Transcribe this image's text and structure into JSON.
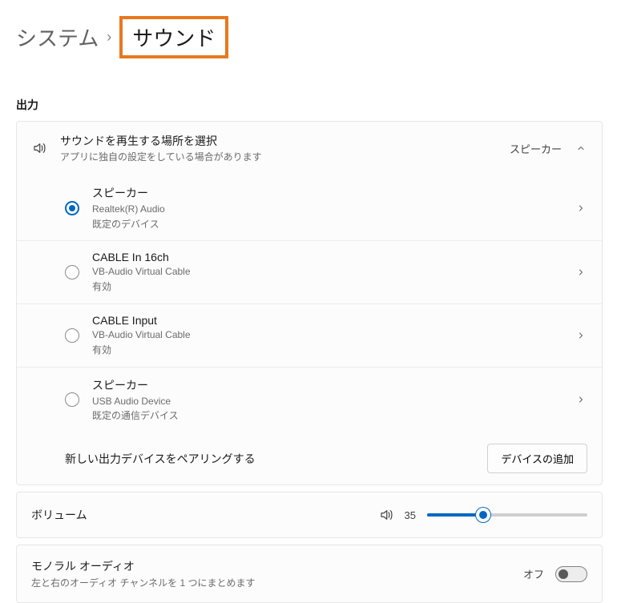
{
  "breadcrumb": {
    "parent": "システム",
    "separator": "›",
    "current": "サウンド"
  },
  "section_output": "出力",
  "output_header": {
    "title": "サウンドを再生する場所を選択",
    "subtitle": "アプリに独自の設定をしている場合があります",
    "value": "スピーカー"
  },
  "devices": [
    {
      "selected": true,
      "name": "スピーカー",
      "line2": "Realtek(R) Audio",
      "line3": "既定のデバイス"
    },
    {
      "selected": false,
      "name": "CABLE In 16ch",
      "line2": "VB-Audio Virtual Cable",
      "line3": "有効"
    },
    {
      "selected": false,
      "name": "CABLE Input",
      "line2": "VB-Audio Virtual Cable",
      "line3": "有効"
    },
    {
      "selected": false,
      "name": "スピーカー",
      "line2": "USB Audio Device",
      "line3": "既定の通信デバイス"
    }
  ],
  "pair": {
    "label": "新しい出力デバイスをペアリングする",
    "button": "デバイスの追加"
  },
  "volume": {
    "label": "ボリューム",
    "value": 35,
    "min": 0,
    "max": 100
  },
  "mono": {
    "title": "モノラル オーディオ",
    "subtitle": "左と右のオーディオ チャンネルを 1 つにまとめます",
    "state_label": "オフ",
    "on": false
  }
}
